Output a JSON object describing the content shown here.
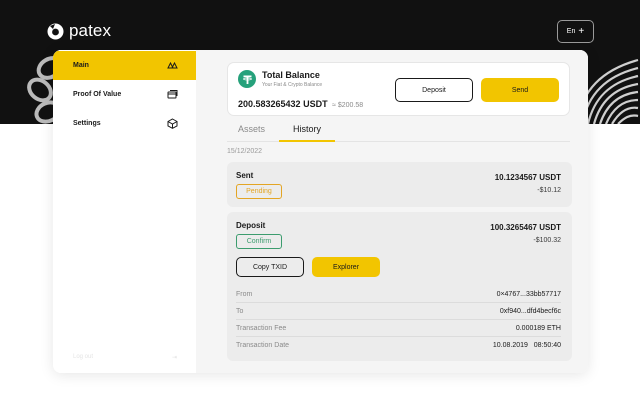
{
  "app": {
    "logo_text": "patex"
  },
  "header": {
    "language": "En"
  },
  "sidebar": {
    "items": [
      {
        "label": "Main",
        "icon": "crypto-icon",
        "active": true
      },
      {
        "label": "Proof Of Value",
        "icon": "cards-icon",
        "active": false
      },
      {
        "label": "Settings",
        "icon": "cube-icon",
        "active": false
      }
    ],
    "footer_label": "Log out"
  },
  "balance": {
    "title": "Total Balance",
    "subtitle": "Your Fiat & Crypto Balance",
    "amount": "200.583265432 USDT",
    "approx": "≈ $200.58",
    "deposit_label": "Deposit",
    "send_label": "Send"
  },
  "tabs": {
    "assets": "Assets",
    "history": "History",
    "active": "History"
  },
  "history": {
    "date": "15/12/2022",
    "transactions": [
      {
        "type": "Sent",
        "status": "Pending",
        "amount": "10.1234567 USDT",
        "fiat": "-$10.12"
      },
      {
        "type": "Deposit",
        "status": "Confirm",
        "amount": "100.3265467 USDT",
        "fiat": "-$100.32",
        "copy_label": "Copy TXID",
        "explorer_label": "Explorer",
        "details": [
          {
            "key": "From",
            "value": "0×4767...33bb57717"
          },
          {
            "key": "To",
            "value": "0xf940...dfd4becf6c"
          },
          {
            "key": "Transaction Fee",
            "value": "0.000189 ETH"
          },
          {
            "key": "Transaction Date",
            "value": "10.08.2019   08:50:40"
          }
        ]
      }
    ]
  },
  "colors": {
    "accent": "#f2c500",
    "pending": "#e3a524",
    "confirm": "#3c9c6e",
    "tether": "#26a17b",
    "topbar": "#111111"
  }
}
